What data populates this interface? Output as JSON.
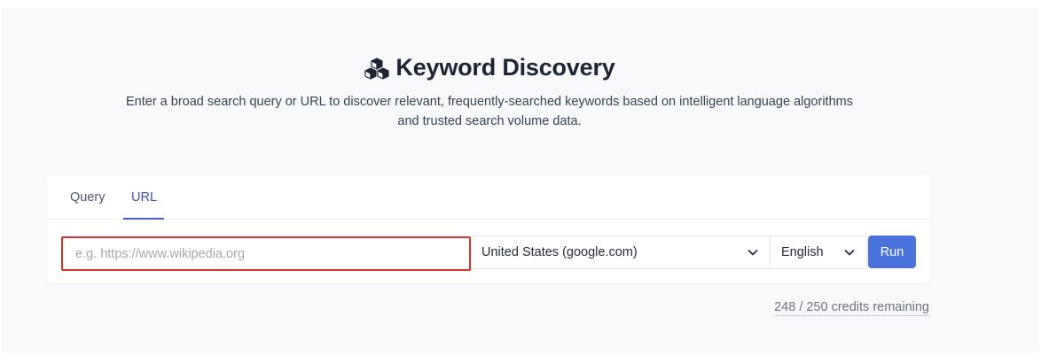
{
  "header": {
    "title": "Keyword Discovery",
    "title_icon": "cubes-icon",
    "subtitle_line1": "Enter a broad search query or URL to discover relevant, frequently-searched keywords based on intelligent language algorithms",
    "subtitle_line2": "and trusted search volume data."
  },
  "tabs": [
    {
      "label": "Query",
      "active": false
    },
    {
      "label": "URL",
      "active": true
    }
  ],
  "form": {
    "url_placeholder": "e.g. https://www.wikipedia.org",
    "url_value": "",
    "country_value": "United States (google.com)",
    "language_value": "English",
    "run_label": "Run"
  },
  "credits": {
    "text": "248 / 250 credits remaining"
  },
  "colors": {
    "accent": "#4a74d9",
    "tab_active": "#3f51b5",
    "highlight_border": "#d9302c",
    "page_bg": "#f8f9fa"
  }
}
